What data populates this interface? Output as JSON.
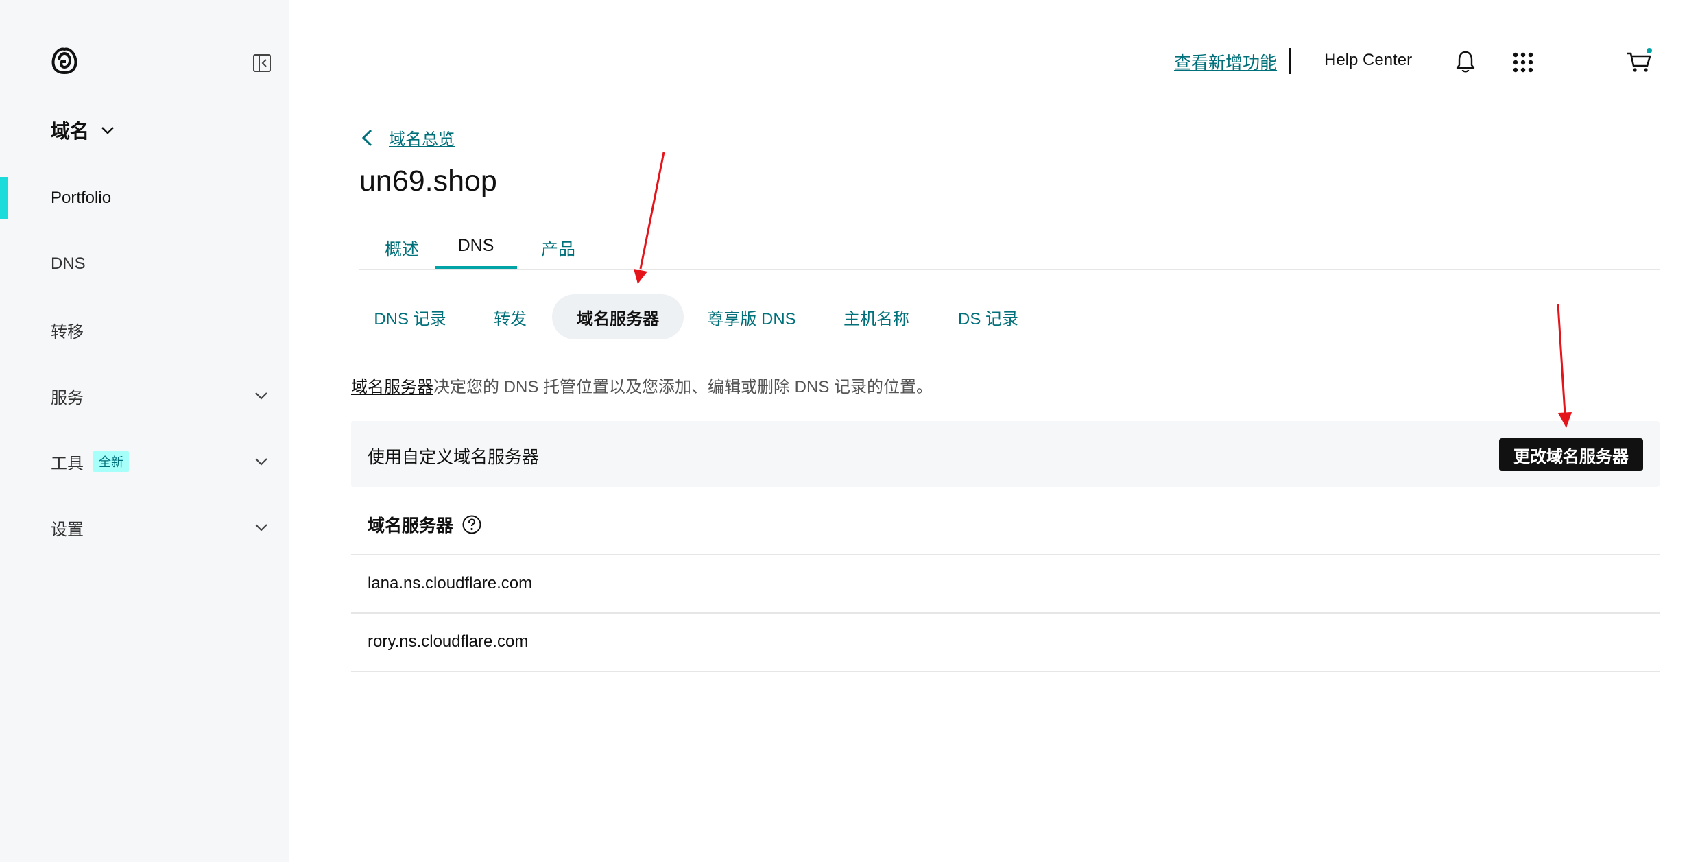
{
  "sidebar": {
    "section_title": "域名",
    "items": [
      {
        "label": "Portfolio"
      },
      {
        "label": "DNS"
      },
      {
        "label": "转移"
      },
      {
        "label": "服务"
      },
      {
        "label": "工具",
        "badge": "全新"
      },
      {
        "label": "设置"
      }
    ]
  },
  "topbar": {
    "whats_new": "查看新增功能",
    "help": "Help Center"
  },
  "breadcrumb": {
    "label": "域名总览"
  },
  "domain": {
    "name": "un69.shop"
  },
  "tabs": [
    {
      "label": "概述"
    },
    {
      "label": "DNS"
    },
    {
      "label": "产品"
    }
  ],
  "subtabs": [
    {
      "label": "DNS 记录"
    },
    {
      "label": "转发"
    },
    {
      "label": "域名服务器"
    },
    {
      "label": "尊享版 DNS"
    },
    {
      "label": "主机名称"
    },
    {
      "label": "DS 记录"
    }
  ],
  "description": {
    "link": "域名服务器",
    "text": "决定您的 DNS 托管位置以及您添加、编辑或删除 DNS 记录的位置。"
  },
  "nameserver_panel": {
    "status": "使用自定义域名服务器",
    "change_button": "更改域名服务器",
    "list_header": "域名服务器",
    "servers": [
      "lana.ns.cloudflare.com",
      "rory.ns.cloudflare.com"
    ]
  },
  "colors": {
    "accent_teal": "#00707a",
    "active_indicator": "#1bdbdb",
    "cart_dot": "#00a4a6",
    "annotation_arrow": "#e5141b"
  }
}
